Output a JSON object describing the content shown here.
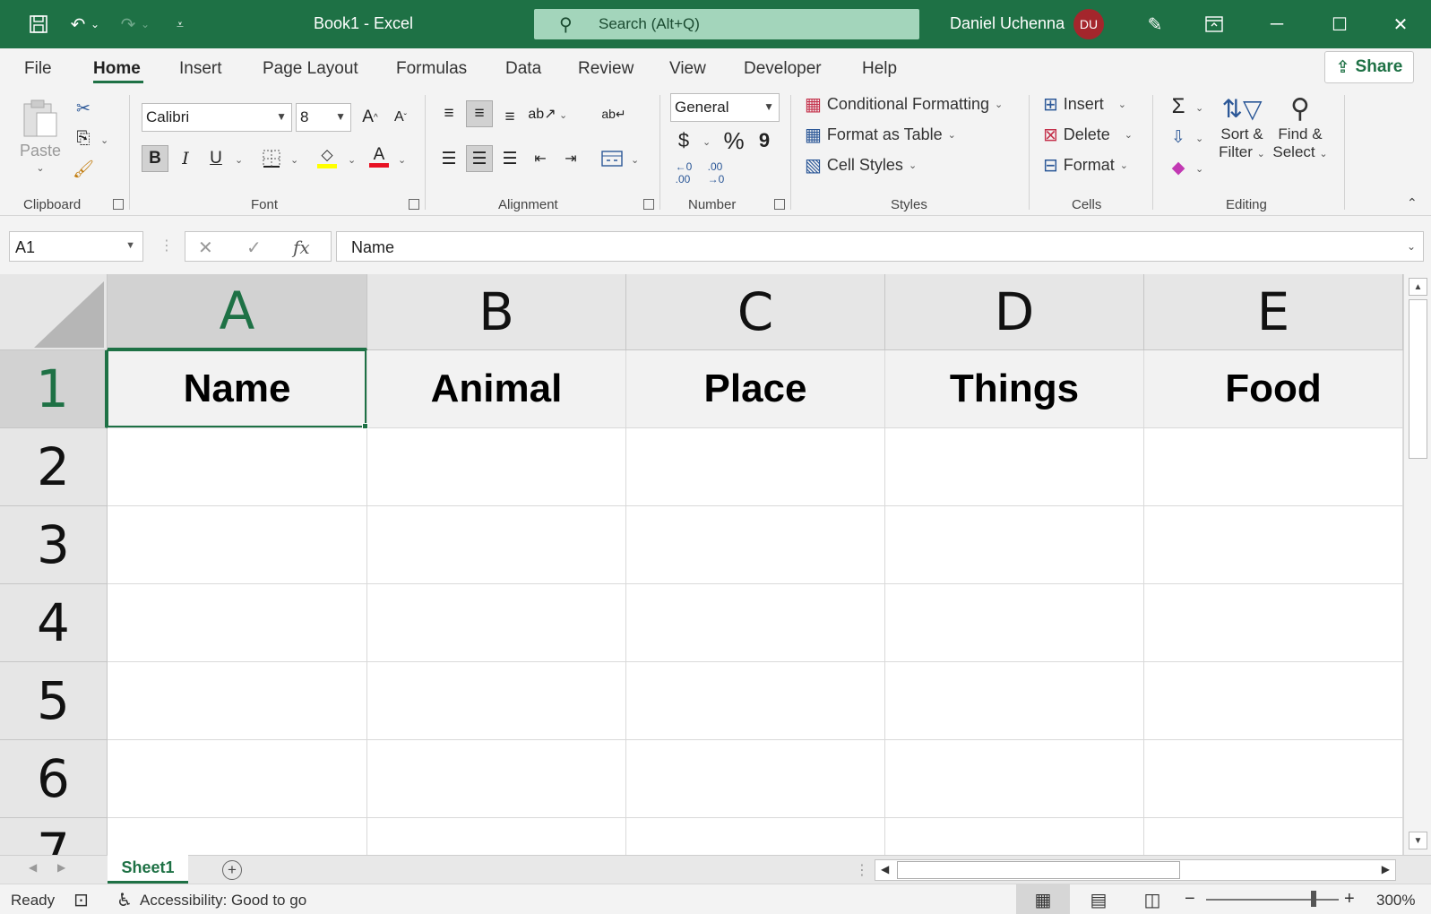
{
  "titlebar": {
    "title": "Book1  -  Excel",
    "search_placeholder": "Search (Alt+Q)",
    "user_name": "Daniel Uchenna",
    "avatar_initials": "DU",
    "accent": "#1e7145"
  },
  "menu": {
    "tabs": [
      "File",
      "Home",
      "Insert",
      "Page Layout",
      "Formulas",
      "Data",
      "Review",
      "View",
      "Developer",
      "Help"
    ],
    "active": "Home",
    "share_label": "Share"
  },
  "ribbon": {
    "clipboard": {
      "label": "Clipboard",
      "paste": "Paste"
    },
    "font": {
      "label": "Font",
      "family": "Calibri",
      "size": "8",
      "bold": "B",
      "italic": "I",
      "underline": "U"
    },
    "alignment": {
      "label": "Alignment"
    },
    "number": {
      "label": "Number",
      "format": "General",
      "currency": "$",
      "percent": "%",
      "comma": "9"
    },
    "styles": {
      "label": "Styles",
      "conditional": "Conditional Formatting",
      "format_table": "Format as Table",
      "cell_styles": "Cell Styles"
    },
    "cells": {
      "label": "Cells",
      "insert": "Insert",
      "delete": "Delete",
      "format": "Format"
    },
    "editing": {
      "label": "Editing",
      "sort_line1": "Sort &",
      "sort_line2": "Filter",
      "find_line1": "Find &",
      "find_line2": "Select"
    }
  },
  "formula_bar": {
    "name_box": "A1",
    "content": "Name"
  },
  "sheet": {
    "columns": [
      "A",
      "B",
      "C",
      "D",
      "E"
    ],
    "rows": [
      "1",
      "2",
      "3",
      "4",
      "5",
      "6",
      "7"
    ],
    "headers": [
      "Name",
      "Animal",
      "Place",
      "Things",
      "Food"
    ],
    "selected_cell": "A1"
  },
  "sheet_tabs": {
    "active": "Sheet1"
  },
  "status": {
    "ready": "Ready",
    "accessibility": "Accessibility: Good to go",
    "zoom": "300%"
  }
}
